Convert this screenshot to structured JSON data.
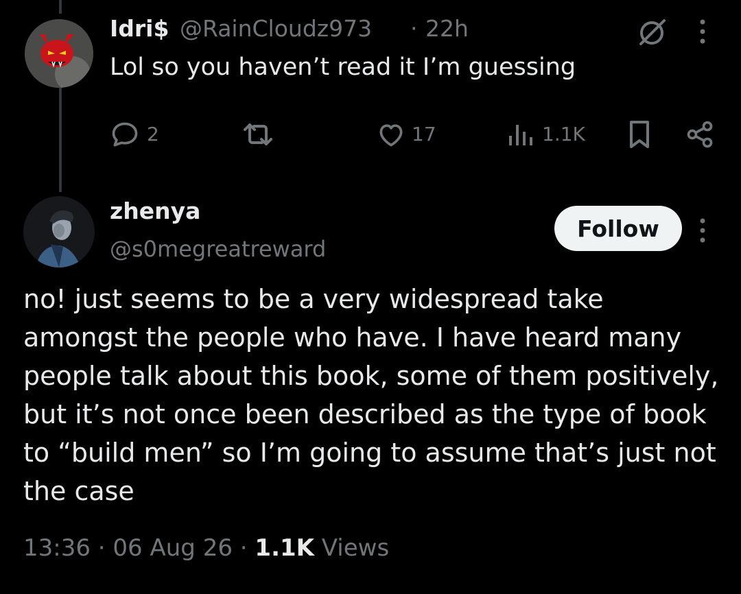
{
  "reply": {
    "display_name": "Idri$",
    "handle": "@RainCloudz973",
    "separator": "·",
    "time_ago": "22h",
    "text": "Lol so you haven’t read it I’m guessing",
    "avatar_icon": "red-devil-cat-avatar",
    "actions": {
      "reply_count": "2",
      "retweet_count": "",
      "like_count": "17",
      "views_count": "1.1K"
    }
  },
  "main_tweet": {
    "display_name": "zhenya",
    "handle": "@s0megreatreward",
    "follow_label": "Follow",
    "avatar_icon": "portrait-avatar",
    "text": "no! just seems to be a very widespread take amongst the people who have. I have heard many people talk about this book, some of them positively, but it’s not once been described as the type of book to “build men” so I’m going to assume that’s just not the case",
    "time": "13:36",
    "date": "06 Aug 26",
    "dot": "·",
    "views_count": "1.1K",
    "views_label": "Views"
  },
  "colors": {
    "background": "#000000",
    "text_primary": "#e7e9ea",
    "text_muted": "#71767b",
    "follow_bg": "#eff3f4",
    "follow_text": "#0f1419",
    "thread_line": "#333639"
  }
}
